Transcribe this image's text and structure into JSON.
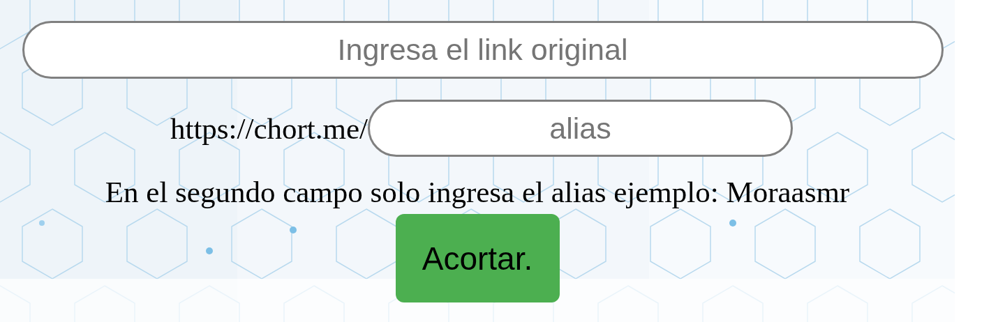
{
  "url_field": {
    "placeholder": "Ingresa el link original"
  },
  "alias_row": {
    "prefix": "https://chort.me/",
    "alias_field": {
      "placeholder": "alias"
    }
  },
  "hint": "En el segundo campo solo ingresa el alias ejemplo: Moraasmr",
  "submit_button": "Acortar."
}
